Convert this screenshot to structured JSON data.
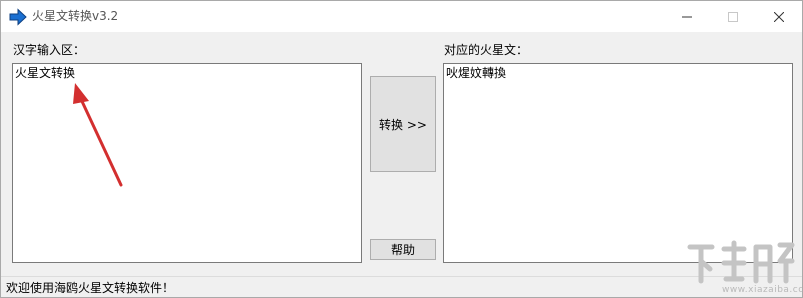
{
  "window": {
    "title": "火星文转换v3.2"
  },
  "left_panel": {
    "label": "汉字输入区：",
    "value": "火星文转换"
  },
  "right_panel": {
    "label": "对应的火星文：",
    "value": "吙煋妏轉換"
  },
  "buttons": {
    "convert_label": "转换 >>",
    "help_label": "帮助"
  },
  "status": {
    "text": "欢迎使用海鸥火星文转换软件！"
  },
  "watermark": {
    "url_text": "www.xiazaiba.com"
  },
  "colors": {
    "annotation_arrow": "#d32f2f",
    "app_icon": "#1a6fd1"
  }
}
